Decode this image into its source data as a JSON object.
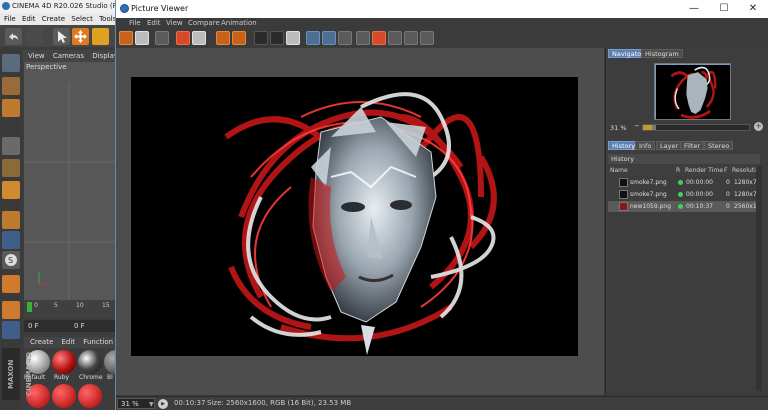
{
  "c4d": {
    "title": "CINEMA 4D R20.026 Studio (RC -",
    "menu": [
      "File",
      "Edit",
      "Create",
      "Select",
      "Tools"
    ],
    "viewport_tabs": [
      "View",
      "Cameras",
      "Display"
    ],
    "viewport_label": "Perspective",
    "timeline_ticks": [
      "0",
      "5",
      "10",
      "15"
    ],
    "frame_field": "0 F",
    "frame_field2": "0 F",
    "material_menu": [
      "Create",
      "Edit",
      "Function"
    ],
    "materials": [
      "Refault",
      "Ruby",
      "Chrome",
      "Bl"
    ],
    "maxon_label": "MAXON CINEMA 4D"
  },
  "window": {
    "title": "Picture Viewer",
    "minimize": "—",
    "maximize": "☐",
    "close": "✕"
  },
  "menu": [
    "File",
    "Edit",
    "View",
    "Compare",
    "Animation"
  ],
  "navigator": {
    "tabs": [
      "Navigator",
      "Histogram"
    ],
    "active_tab": "Navigator",
    "zoom": "31 %",
    "slider_fraction": 0.12
  },
  "history": {
    "tabs": [
      "History",
      "Info",
      "Layer",
      "Filter",
      "Stereo"
    ],
    "active_tab": "History",
    "section_title": "History",
    "columns": [
      "Name",
      "R",
      "Render Time",
      "F",
      "Resolutio"
    ],
    "rows": [
      {
        "name": "smoke7.png",
        "render_time": "00:00:00",
        "frame": "0",
        "resolution": "1280x72",
        "thumb": "dark",
        "selected": false
      },
      {
        "name": "smoke7.png",
        "render_time": "00:00:00",
        "frame": "0",
        "resolution": "1280x72",
        "thumb": "dark",
        "selected": false
      },
      {
        "name": "new1059.png",
        "render_time": "00:10:37",
        "frame": "0",
        "resolution": "2560x1",
        "thumb": "red",
        "selected": true
      }
    ]
  },
  "status": {
    "zoom": "31 %",
    "time": "00:10:37",
    "size": "Size: 2560x1600, RGB (16 Bit), 23.53 MB"
  },
  "colors": {
    "accent": "#5a7fb0",
    "render_red": "#d01818",
    "status_green": "#44d05a"
  }
}
